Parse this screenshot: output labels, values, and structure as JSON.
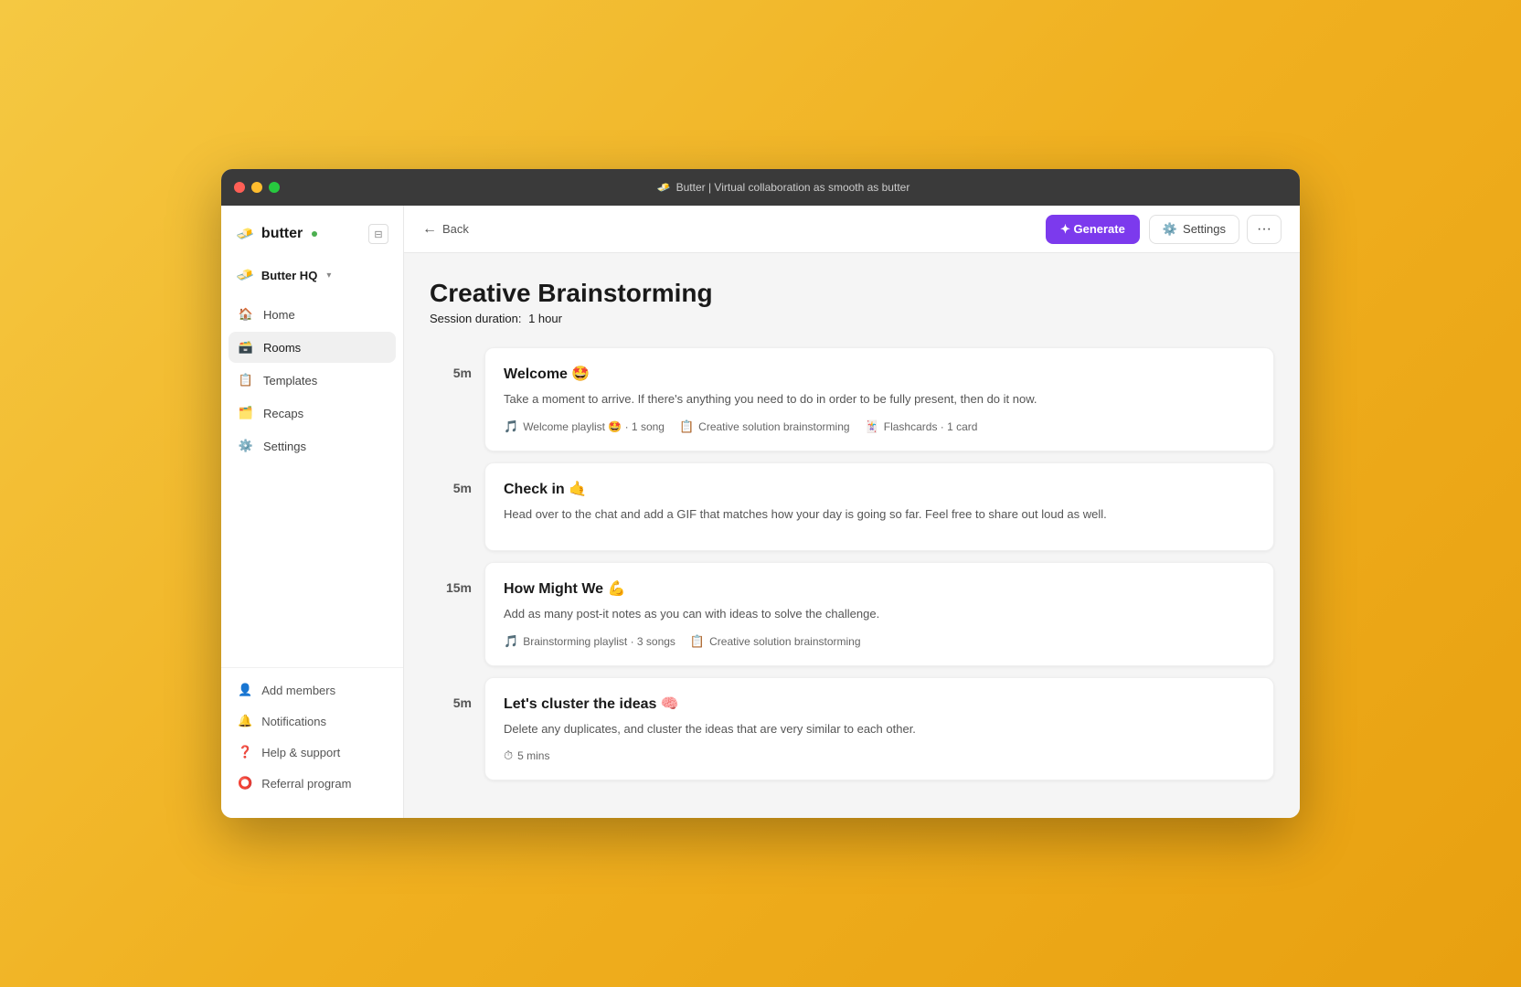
{
  "window": {
    "title": "Butter | Virtual collaboration as smooth as butter",
    "titleEmoji": "🧈"
  },
  "sidebar": {
    "logo": {
      "text": "butter",
      "statusDot": true
    },
    "workspace": {
      "name": "Butter HQ",
      "hasChevron": true
    },
    "navItems": [
      {
        "id": "home",
        "label": "Home",
        "icon": "🏠",
        "active": false
      },
      {
        "id": "rooms",
        "label": "Rooms",
        "icon": "🗃️",
        "active": true
      },
      {
        "id": "templates",
        "label": "Templates",
        "icon": "📋",
        "active": false
      },
      {
        "id": "recaps",
        "label": "Recaps",
        "icon": "🗂️",
        "active": false
      },
      {
        "id": "settings",
        "label": "Settings",
        "icon": "⚙️",
        "active": false
      }
    ],
    "bottomItems": [
      {
        "id": "add-members",
        "label": "Add members",
        "icon": "👤"
      },
      {
        "id": "notifications",
        "label": "Notifications",
        "icon": "🔔"
      },
      {
        "id": "help",
        "label": "Help & support",
        "icon": "❓"
      },
      {
        "id": "referral",
        "label": "Referral program",
        "icon": "⭕"
      }
    ]
  },
  "topbar": {
    "backLabel": "Back",
    "generateLabel": "✦ Generate",
    "settingsLabel": "Settings",
    "moreLabel": "···"
  },
  "page": {
    "title": "Creative Brainstorming",
    "sessionDurationLabel": "Session duration:",
    "sessionDurationValue": "1 hour"
  },
  "agendaItems": [
    {
      "time": "5m",
      "title": "Welcome 🤩",
      "description": "Take a moment to arrive. If there's anything you need to do in order to be fully present, then do it now.",
      "tags": [
        {
          "icon": "🎵",
          "label": "Welcome playlist 🤩 · 1 song"
        },
        {
          "icon": "📋",
          "label": "Creative solution brainstorming"
        },
        {
          "icon": "🃏",
          "label": "Flashcards · 1 card"
        }
      ]
    },
    {
      "time": "5m",
      "title": "Check in 🤙",
      "description": "Head over to the chat and add a GIF that matches how your day is going so far. Feel free to share out loud as well.",
      "tags": []
    },
    {
      "time": "15m",
      "title": "How Might We 💪",
      "description": "Add as many post-it notes as you can with ideas to solve the challenge.",
      "tags": [
        {
          "icon": "🎵",
          "label": "Brainstorming playlist · 3 songs"
        },
        {
          "icon": "📋",
          "label": "Creative solution brainstorming"
        }
      ]
    },
    {
      "time": "5m",
      "title": "Let's cluster the ideas 🧠",
      "description": "Delete any duplicates, and cluster the ideas that are very similar to each other.",
      "tags": [
        {
          "icon": "⏱",
          "label": "5 mins"
        }
      ]
    }
  ]
}
